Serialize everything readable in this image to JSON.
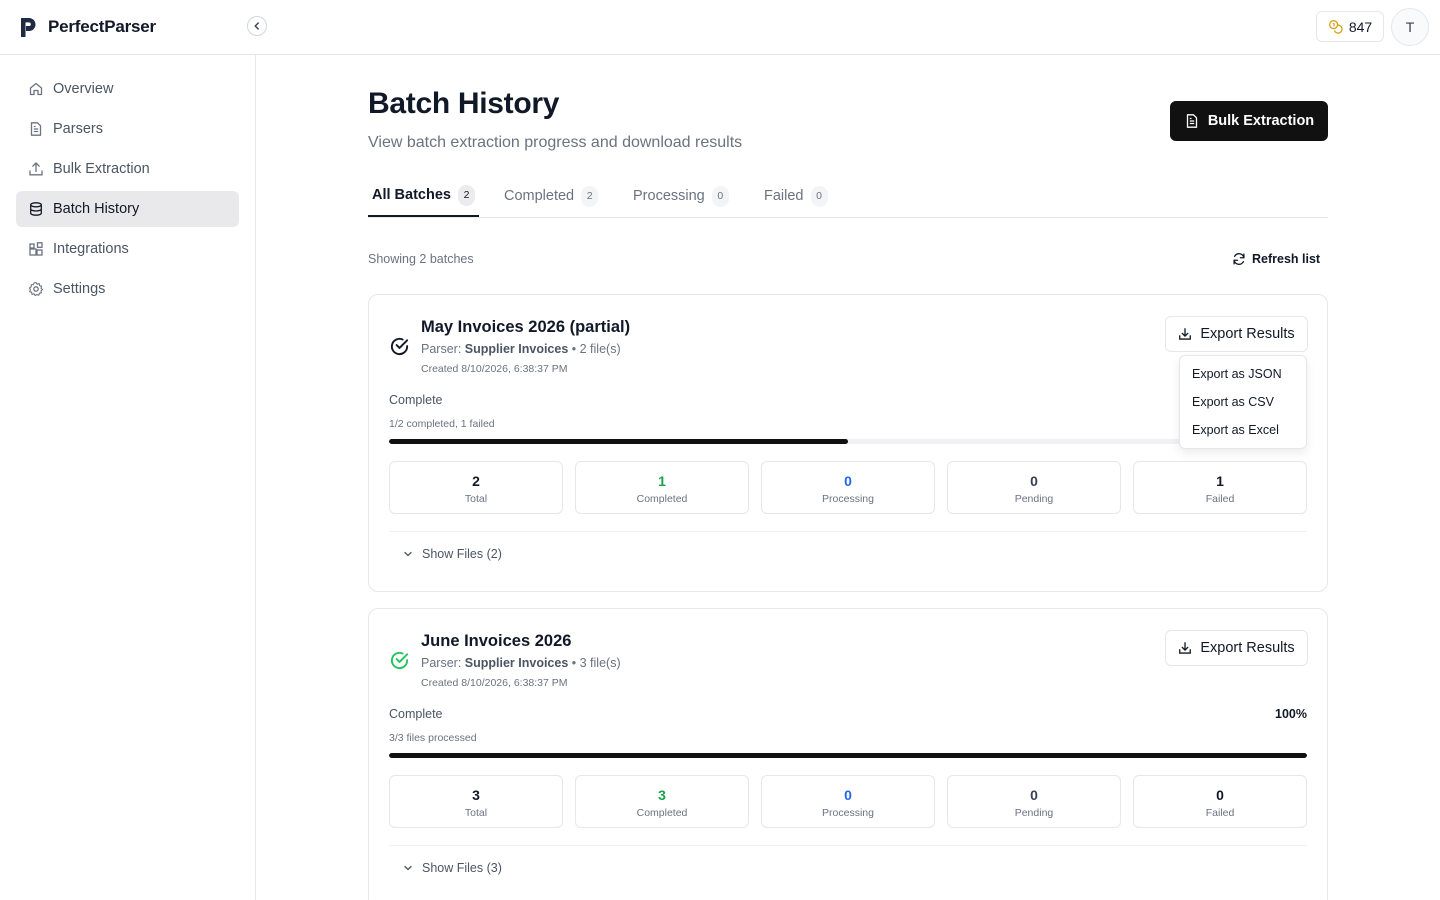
{
  "app": {
    "name": "PerfectParser",
    "credits": "847",
    "avatar_initial": "T"
  },
  "sidebar": {
    "items": [
      {
        "label": "Overview",
        "icon": "home-icon"
      },
      {
        "label": "Parsers",
        "icon": "document-icon"
      },
      {
        "label": "Bulk Extraction",
        "icon": "upload-icon"
      },
      {
        "label": "Batch History",
        "icon": "database-icon",
        "active": true
      },
      {
        "label": "Integrations",
        "icon": "blocks-icon"
      },
      {
        "label": "Settings",
        "icon": "gear-icon"
      }
    ]
  },
  "header": {
    "title": "Batch History",
    "subtitle": "View batch extraction progress and download results",
    "bulk_button": "Bulk Extraction"
  },
  "tabs": [
    {
      "label": "All Batches",
      "count": "2",
      "active": true
    },
    {
      "label": "Completed",
      "count": "2"
    },
    {
      "label": "Processing",
      "count": "0"
    },
    {
      "label": "Failed",
      "count": "0"
    }
  ],
  "list": {
    "showing": "Showing 2 batches",
    "refresh_label": "Refresh list"
  },
  "batches": [
    {
      "title": "May Invoices 2026 (partial)",
      "parser_prefix": "Parser:",
      "parser": "Supplier Invoices",
      "files": "• 2 file(s)",
      "created": "Created 8/10/2026, 6:38:37 PM",
      "export_label": "Export Results",
      "status": "Complete",
      "detail": "1/2 completed, 1 failed",
      "percent": "",
      "progress": 0.5,
      "status_color": "#111827",
      "stats": [
        {
          "value": "2",
          "label": "Total",
          "color": "#111827"
        },
        {
          "value": "1",
          "label": "Completed",
          "color": "#16a34a"
        },
        {
          "value": "0",
          "label": "Processing",
          "color": "#2563eb"
        },
        {
          "value": "0",
          "label": "Pending",
          "color": "#374151"
        },
        {
          "value": "1",
          "label": "Failed",
          "color": "#111827"
        }
      ],
      "show_files": "Show Files (2)"
    },
    {
      "title": "June Invoices 2026",
      "parser_prefix": "Parser:",
      "parser": "Supplier Invoices",
      "files": "• 3 file(s)",
      "created": "Created 8/10/2026, 6:38:37 PM",
      "export_label": "Export Results",
      "status": "Complete",
      "detail": "3/3 files processed",
      "percent": "100%",
      "progress": 1.0,
      "status_color": "#22c55e",
      "stats": [
        {
          "value": "3",
          "label": "Total",
          "color": "#111827"
        },
        {
          "value": "3",
          "label": "Completed",
          "color": "#16a34a"
        },
        {
          "value": "0",
          "label": "Processing",
          "color": "#2563eb"
        },
        {
          "value": "0",
          "label": "Pending",
          "color": "#374151"
        },
        {
          "value": "0",
          "label": "Failed",
          "color": "#111827"
        }
      ],
      "show_files": "Show Files (3)"
    }
  ],
  "export_menu": {
    "items": [
      "Export as JSON",
      "Export as CSV",
      "Export as Excel"
    ]
  }
}
